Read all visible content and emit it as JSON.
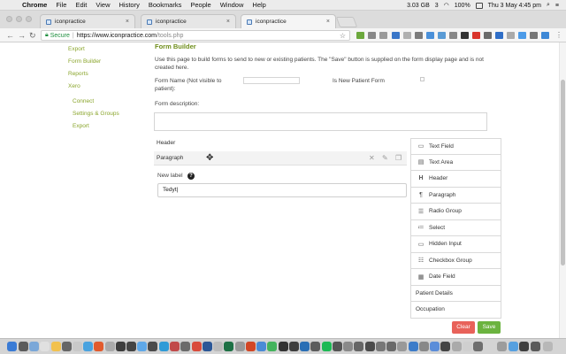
{
  "menubar": {
    "app": "Chrome",
    "items": [
      "File",
      "Edit",
      "View",
      "History",
      "Bookmarks",
      "People",
      "Window",
      "Help"
    ],
    "memory": "3.03 GB",
    "badge": "3",
    "battery": "100%",
    "datetime": "Thu 3 May  4:45 pm"
  },
  "tabs": [
    {
      "title": "iconpractice",
      "close": "×"
    },
    {
      "title": "iconpractice",
      "close": "×"
    },
    {
      "title": "iconpractice",
      "close": "×"
    }
  ],
  "toolbar": {
    "back": "←",
    "forward": "→",
    "reload": "↻",
    "secure_label": "Secure",
    "url_host": "https://www.iconpractice.com",
    "url_path": "/tools.php"
  },
  "sidebar": {
    "items": [
      "Export",
      "Form Builder",
      "Reports",
      "Xero"
    ],
    "subitems": [
      "Connect",
      "Settings & Groups",
      "Export"
    ]
  },
  "main": {
    "title": "Form Builder",
    "description": "Use this page to build forms to send to new or existing patients. The \"Save\" button is supplied on the form display page and is not created here.",
    "form_name_label": "Form Name (Not visible to patient):",
    "new_patient_label": "Is New Patient Form",
    "form_description_label": "Form description:",
    "header_item": "Header",
    "paragraph_item": "Paragraph",
    "new_label_label": "New label",
    "new_label_help": "?",
    "new_label_value": "Tedyt|",
    "clear_button": "Clear",
    "save_button": "Save"
  },
  "palette": [
    {
      "label": "Text Field",
      "icon": "text-field-icon"
    },
    {
      "label": "Text Area",
      "icon": "text-area-icon"
    },
    {
      "label": "Header",
      "icon": "header-icon"
    },
    {
      "label": "Paragraph",
      "icon": "paragraph-icon"
    },
    {
      "label": "Radio Group",
      "icon": "radio-group-icon"
    },
    {
      "label": "Select",
      "icon": "select-icon"
    },
    {
      "label": "Hidden Input",
      "icon": "hidden-input-icon"
    },
    {
      "label": "Checkbox Group",
      "icon": "checkbox-group-icon"
    },
    {
      "label": "Date Field",
      "icon": "calendar-icon"
    },
    {
      "label": "Patient Details"
    },
    {
      "label": "Occupation"
    }
  ]
}
